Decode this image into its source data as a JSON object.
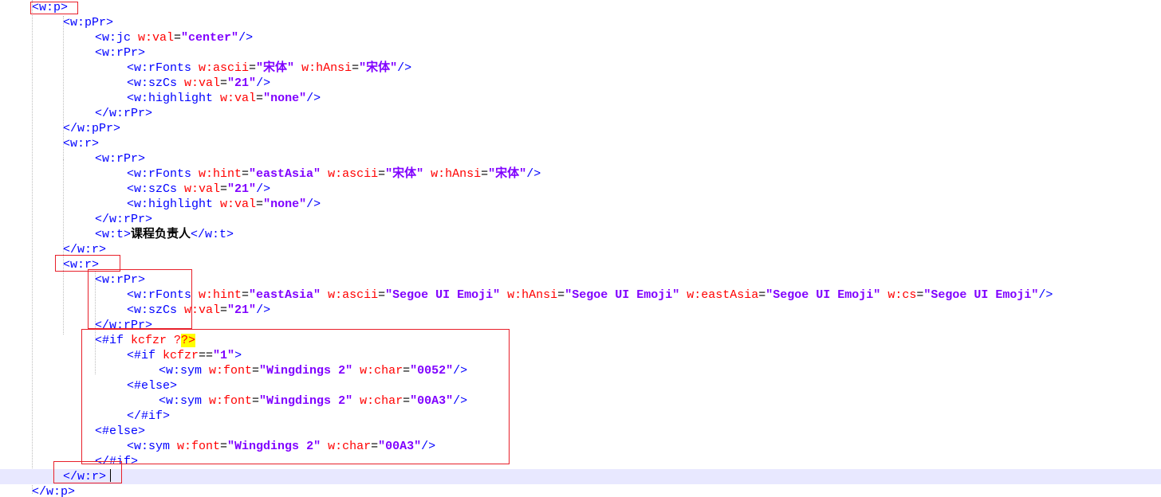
{
  "editor": {
    "current_line": 31,
    "lines": [
      [
        [
          "tag",
          "<w:p>"
        ]
      ],
      [
        [
          "tag",
          "<w:pPr>"
        ]
      ],
      [
        [
          "tag",
          "<w:jc "
        ],
        [
          "attr",
          "w:val"
        ],
        [
          "punc",
          "="
        ],
        [
          "val",
          "\"center\""
        ],
        [
          "tag",
          "/>"
        ]
      ],
      [
        [
          "tag",
          "<w:rPr>"
        ]
      ],
      [
        [
          "tag",
          "<w:rFonts "
        ],
        [
          "attr",
          "w:ascii"
        ],
        [
          "punc",
          "="
        ],
        [
          "val",
          "\"宋体\""
        ],
        [
          "tag",
          " "
        ],
        [
          "attr",
          "w:hAnsi"
        ],
        [
          "punc",
          "="
        ],
        [
          "val",
          "\"宋体\""
        ],
        [
          "tag",
          "/>"
        ]
      ],
      [
        [
          "tag",
          "<w:szCs "
        ],
        [
          "attr",
          "w:val"
        ],
        [
          "punc",
          "="
        ],
        [
          "val",
          "\"21\""
        ],
        [
          "tag",
          "/>"
        ]
      ],
      [
        [
          "tag",
          "<w:highlight "
        ],
        [
          "attr",
          "w:val"
        ],
        [
          "punc",
          "="
        ],
        [
          "val",
          "\"none\""
        ],
        [
          "tag",
          "/>"
        ]
      ],
      [
        [
          "tag",
          "</w:rPr>"
        ]
      ],
      [
        [
          "tag",
          "</w:pPr>"
        ]
      ],
      [
        [
          "tag",
          "<w:r>"
        ]
      ],
      [
        [
          "tag",
          "<w:rPr>"
        ]
      ],
      [
        [
          "tag",
          "<w:rFonts "
        ],
        [
          "attr",
          "w:hint"
        ],
        [
          "punc",
          "="
        ],
        [
          "val",
          "\"eastAsia\""
        ],
        [
          "tag",
          " "
        ],
        [
          "attr",
          "w:ascii"
        ],
        [
          "punc",
          "="
        ],
        [
          "val",
          "\"宋体\""
        ],
        [
          "tag",
          " "
        ],
        [
          "attr",
          "w:hAnsi"
        ],
        [
          "punc",
          "="
        ],
        [
          "val",
          "\"宋体\""
        ],
        [
          "tag",
          "/>"
        ]
      ],
      [
        [
          "tag",
          "<w:szCs "
        ],
        [
          "attr",
          "w:val"
        ],
        [
          "punc",
          "="
        ],
        [
          "val",
          "\"21\""
        ],
        [
          "tag",
          "/>"
        ]
      ],
      [
        [
          "tag",
          "<w:highlight "
        ],
        [
          "attr",
          "w:val"
        ],
        [
          "punc",
          "="
        ],
        [
          "val",
          "\"none\""
        ],
        [
          "tag",
          "/>"
        ]
      ],
      [
        [
          "tag",
          "</w:rPr>"
        ]
      ],
      [
        [
          "tag",
          "<w:t>"
        ],
        [
          "txt",
          "课程负责人"
        ],
        [
          "tag",
          "</w:t>"
        ]
      ],
      [
        [
          "tag",
          "</w:r>"
        ]
      ],
      [
        [
          "tag",
          "<w:r>"
        ]
      ],
      [
        [
          "tag",
          "<w:rPr>"
        ]
      ],
      [
        [
          "tag",
          "<w:rFonts "
        ],
        [
          "attr",
          "w:hint"
        ],
        [
          "punc",
          "="
        ],
        [
          "val",
          "\"eastAsia\""
        ],
        [
          "tag",
          " "
        ],
        [
          "attr",
          "w:ascii"
        ],
        [
          "punc",
          "="
        ],
        [
          "val",
          "\"Segoe UI Emoji\""
        ],
        [
          "tag",
          " "
        ],
        [
          "attr",
          "w:hAnsi"
        ],
        [
          "punc",
          "="
        ],
        [
          "val",
          "\"Segoe UI Emoji\""
        ],
        [
          "tag",
          " "
        ],
        [
          "attr",
          "w:eastAsia"
        ],
        [
          "punc",
          "="
        ],
        [
          "val",
          "\"Segoe UI Emoji\""
        ],
        [
          "tag",
          " "
        ],
        [
          "attr",
          "w:cs"
        ],
        [
          "punc",
          "="
        ],
        [
          "val",
          "\"Segoe UI Emoji\""
        ],
        [
          "tag",
          "/>"
        ]
      ],
      [
        [
          "tag",
          "<w:szCs "
        ],
        [
          "attr",
          "w:val"
        ],
        [
          "punc",
          "="
        ],
        [
          "val",
          "\"21\""
        ],
        [
          "tag",
          "/>"
        ]
      ],
      [
        [
          "tag",
          "</w:rPr>"
        ]
      ],
      [
        [
          "dir",
          "<#if "
        ],
        [
          "dirkw",
          "kcfzr ?"
        ],
        [
          "hl",
          "?>"
        ]
      ],
      [
        [
          "dir",
          "<#if "
        ],
        [
          "dirkw",
          "kcfzr"
        ],
        [
          "punc",
          "=="
        ],
        [
          "val",
          "\"1\""
        ],
        [
          "dir",
          ">"
        ]
      ],
      [
        [
          "tag",
          "<w:sym "
        ],
        [
          "attr",
          "w:font"
        ],
        [
          "punc",
          "="
        ],
        [
          "val",
          "\"Wingdings 2\""
        ],
        [
          "tag",
          " "
        ],
        [
          "attr",
          "w:char"
        ],
        [
          "punc",
          "="
        ],
        [
          "val",
          "\"0052\""
        ],
        [
          "tag",
          "/>"
        ]
      ],
      [
        [
          "dir",
          "<#else>"
        ]
      ],
      [
        [
          "tag",
          "<w:sym "
        ],
        [
          "attr",
          "w:font"
        ],
        [
          "punc",
          "="
        ],
        [
          "val",
          "\"Wingdings 2\""
        ],
        [
          "tag",
          " "
        ],
        [
          "attr",
          "w:char"
        ],
        [
          "punc",
          "="
        ],
        [
          "val",
          "\"00A3\""
        ],
        [
          "tag",
          "/>"
        ]
      ],
      [
        [
          "dir",
          "</#if>"
        ]
      ],
      [
        [
          "dir",
          "<#else>"
        ]
      ],
      [
        [
          "tag",
          "<w:sym "
        ],
        [
          "attr",
          "w:font"
        ],
        [
          "punc",
          "="
        ],
        [
          "val",
          "\"Wingdings 2\""
        ],
        [
          "tag",
          " "
        ],
        [
          "attr",
          "w:char"
        ],
        [
          "punc",
          "="
        ],
        [
          "val",
          "\"00A3\""
        ],
        [
          "tag",
          "/>"
        ]
      ],
      [
        [
          "dir",
          "</#if>"
        ]
      ],
      [
        [
          "tag",
          "</w:r>"
        ]
      ],
      [
        [
          "tag",
          "</w:p>"
        ]
      ]
    ]
  }
}
